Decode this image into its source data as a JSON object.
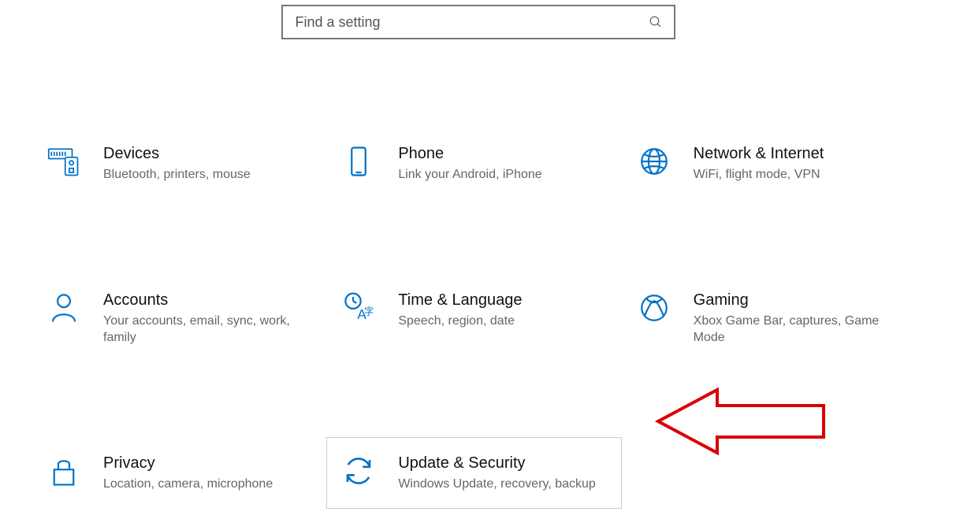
{
  "search": {
    "placeholder": "Find a setting"
  },
  "tiles": [
    {
      "title": "Devices",
      "desc": "Bluetooth, printers, mouse"
    },
    {
      "title": "Phone",
      "desc": "Link your Android, iPhone"
    },
    {
      "title": "Network & Internet",
      "desc": "WiFi, flight mode, VPN"
    },
    {
      "title": "Accounts",
      "desc": "Your accounts, email, sync, work, family"
    },
    {
      "title": "Time & Language",
      "desc": "Speech, region, date"
    },
    {
      "title": "Gaming",
      "desc": "Xbox Game Bar, captures, Game Mode"
    },
    {
      "title": "Privacy",
      "desc": "Location, camera, microphone"
    },
    {
      "title": "Update & Security",
      "desc": "Windows Update, recovery, backup"
    }
  ],
  "colors": {
    "accent": "#0072c6",
    "annotation": "#d90000"
  }
}
